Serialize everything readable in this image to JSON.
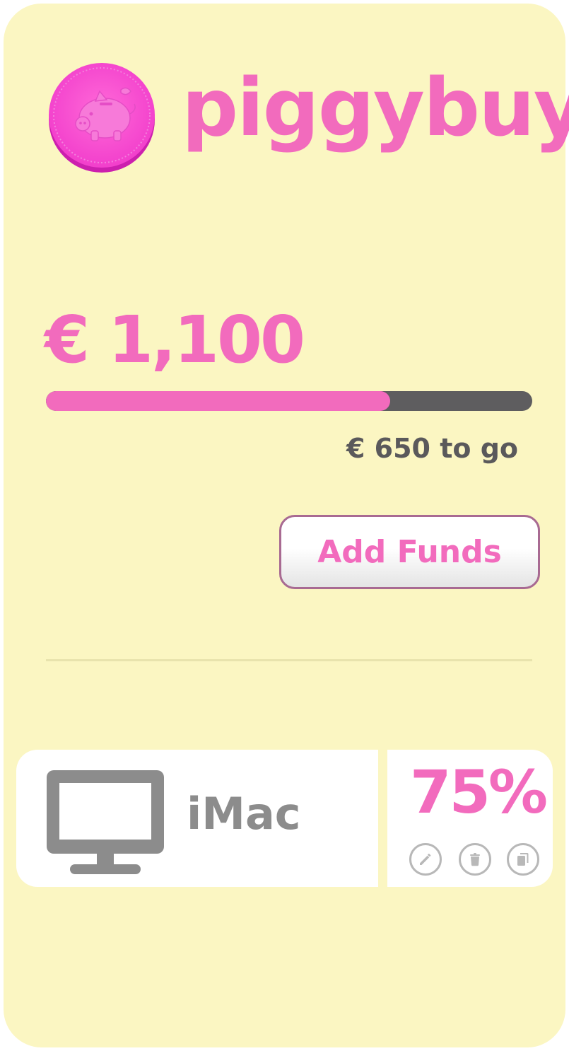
{
  "app": {
    "name": "piggybuy",
    "logo_icon": "piggy-bank-coin-icon"
  },
  "savings": {
    "amount": "€ 1,100",
    "remaining": "€ 650 to go",
    "progress_fraction": 0.708,
    "add_funds_label": "Add Funds"
  },
  "goals": [
    {
      "name": "iMac",
      "icon": "desktop-monitor-icon",
      "percent": "75%",
      "actions": [
        "edit-icon",
        "trash-icon",
        "copy-icon"
      ]
    }
  ],
  "colors": {
    "background": "#fbf6c2",
    "accent": "#f26bbd",
    "track": "#5e5d5f",
    "muted_text": "#5a595b",
    "icon_gray": "#8c8c8c"
  }
}
